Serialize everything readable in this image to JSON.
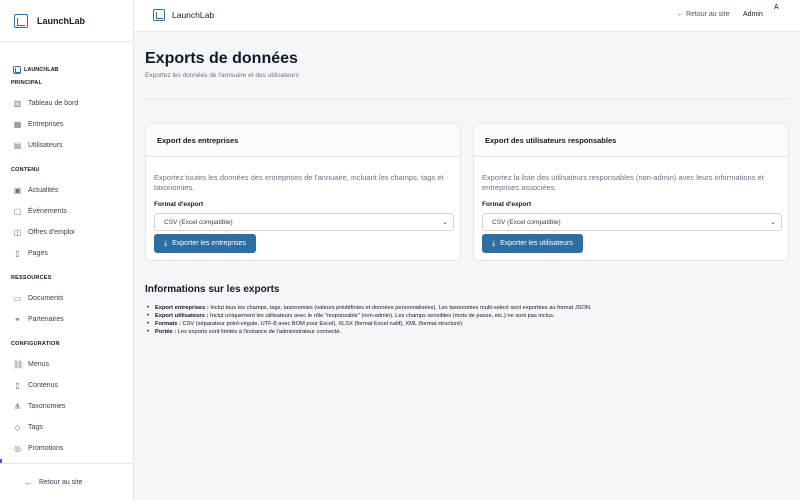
{
  "app": {
    "name": "LaunchLab",
    "small_name": "LAUNCHLAB"
  },
  "sidebar": {
    "sections": [
      {
        "title": "PRINCIPAL",
        "items": [
          {
            "label": "Tableau de bord",
            "icon": "chart-icon"
          },
          {
            "label": "Entreprises",
            "icon": "building-icon"
          },
          {
            "label": "Utilisateurs",
            "icon": "users-icon"
          }
        ]
      },
      {
        "title": "CONTENU",
        "items": [
          {
            "label": "Actualités",
            "icon": "news-icon"
          },
          {
            "label": "Événements",
            "icon": "calendar-icon"
          },
          {
            "label": "Offres d'emploi",
            "icon": "briefcase-icon"
          },
          {
            "label": "Pages",
            "icon": "page-icon"
          }
        ]
      },
      {
        "title": "RESSOURCES",
        "items": [
          {
            "label": "Documents",
            "icon": "folder-icon"
          },
          {
            "label": "Partenaires",
            "icon": "handshake-icon"
          }
        ]
      },
      {
        "title": "CONFIGURATION",
        "items": [
          {
            "label": "Menus",
            "icon": "link-icon"
          },
          {
            "label": "Contenus",
            "icon": "document-icon"
          },
          {
            "label": "Taxonomies",
            "icon": "taxonomy-icon"
          },
          {
            "label": "Tags",
            "icon": "tag-icon"
          },
          {
            "label": "Promotions",
            "icon": "promotion-icon"
          }
        ]
      }
    ],
    "footer_label": "Retour au site"
  },
  "topbar": {
    "brand": "LaunchLab",
    "back_label": "Retour au site",
    "user_label": "Admin",
    "avatar_letter": "A"
  },
  "main": {
    "title": "Exports de données",
    "subtitle": "Exportez les données de l'annuaire et des utilisateurs",
    "cards": [
      {
        "title": "Export des entreprises",
        "description": "Exportez toutes les données des entreprises de l'annuaire, incluant les champs, tags et taxonomies.",
        "format_label": "Format d'export",
        "format_value": "CSV (Excel compatible)",
        "button_label": "Exporter les entreprises"
      },
      {
        "title": "Export des utilisateurs responsables",
        "description": "Exportez la liste des utilisateurs responsables (non-admin) avec leurs informations et entreprises associées.",
        "format_label": "Format d'export",
        "format_value": "CSV (Excel compatible)",
        "button_label": "Exporter les utilisateurs"
      }
    ],
    "info": {
      "title": "Informations sur les exports",
      "items": [
        {
          "term": "Export entreprises :",
          "text": " Inclut tous les champs, tags, taxonomies (valeurs prédéfinies et données personnalisées). Les taxonomies multi-select sont exportées au format JSON."
        },
        {
          "term": "Export utilisateurs :",
          "text": " Inclut uniquement les utilisateurs avec le rôle \"responsable\" (non-admin). Les champs sensibles (mots de passe, etc.) ne sont pas inclus."
        },
        {
          "term": "Formats :",
          "text": " CSV (séparateur point-virgule, UTF-8 avec BOM pour Excel), XLSX (format Excel natif), XML (format structuré)."
        },
        {
          "term": "Portée :",
          "text": " Les exports sont limités à l'instance de l'administrateur connecté."
        }
      ]
    }
  },
  "colors": {
    "primary_button": "#2f6ea2",
    "brand": "#2f6fa3",
    "active_indicator": "#2563eb"
  }
}
